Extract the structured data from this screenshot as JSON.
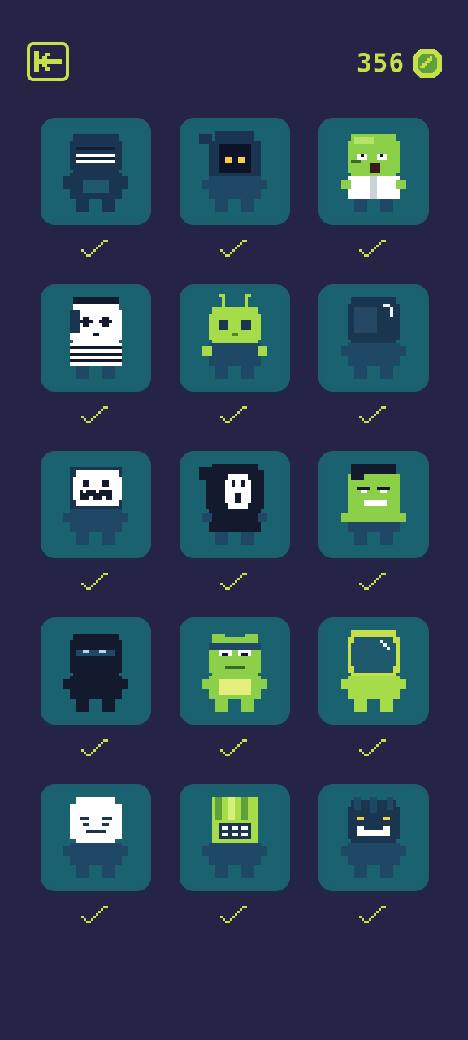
{
  "header": {
    "back_icon": "arrow-left-icon",
    "coin_count": "356",
    "coin_icon": "gem-coin-icon"
  },
  "colors": {
    "background": "#262446",
    "accent": "#c5e04a",
    "tile": "#1a6270"
  },
  "characters": [
    {
      "id": "grinning-dark",
      "icon": "dark-grin-character-icon",
      "unlocked": true
    },
    {
      "id": "hooded-eyes",
      "icon": "hooded-shadow-character-icon",
      "unlocked": true
    },
    {
      "id": "zombie-scientist",
      "icon": "zombie-character-icon",
      "unlocked": true
    },
    {
      "id": "mime",
      "icon": "mime-character-icon",
      "unlocked": true
    },
    {
      "id": "alien-antenna",
      "icon": "alien-character-icon",
      "unlocked": true
    },
    {
      "id": "glossy-helmet",
      "icon": "helmet-character-icon",
      "unlocked": true
    },
    {
      "id": "pumpkin-smile",
      "icon": "smile-mask-character-icon",
      "unlocked": true
    },
    {
      "id": "ghost-scream",
      "icon": "scream-mask-character-icon",
      "unlocked": true
    },
    {
      "id": "green-brute",
      "icon": "brute-character-icon",
      "unlocked": true
    },
    {
      "id": "ninja",
      "icon": "ninja-character-icon",
      "unlocked": true
    },
    {
      "id": "frog-headband",
      "icon": "frog-character-icon",
      "unlocked": true
    },
    {
      "id": "astronaut",
      "icon": "astronaut-character-icon",
      "unlocked": true
    },
    {
      "id": "white-mask",
      "icon": "white-mask-character-icon",
      "unlocked": true
    },
    {
      "id": "robot-block",
      "icon": "block-robot-character-icon",
      "unlocked": true
    },
    {
      "id": "tribal-mask",
      "icon": "tribal-mask-character-icon",
      "unlocked": true
    }
  ]
}
